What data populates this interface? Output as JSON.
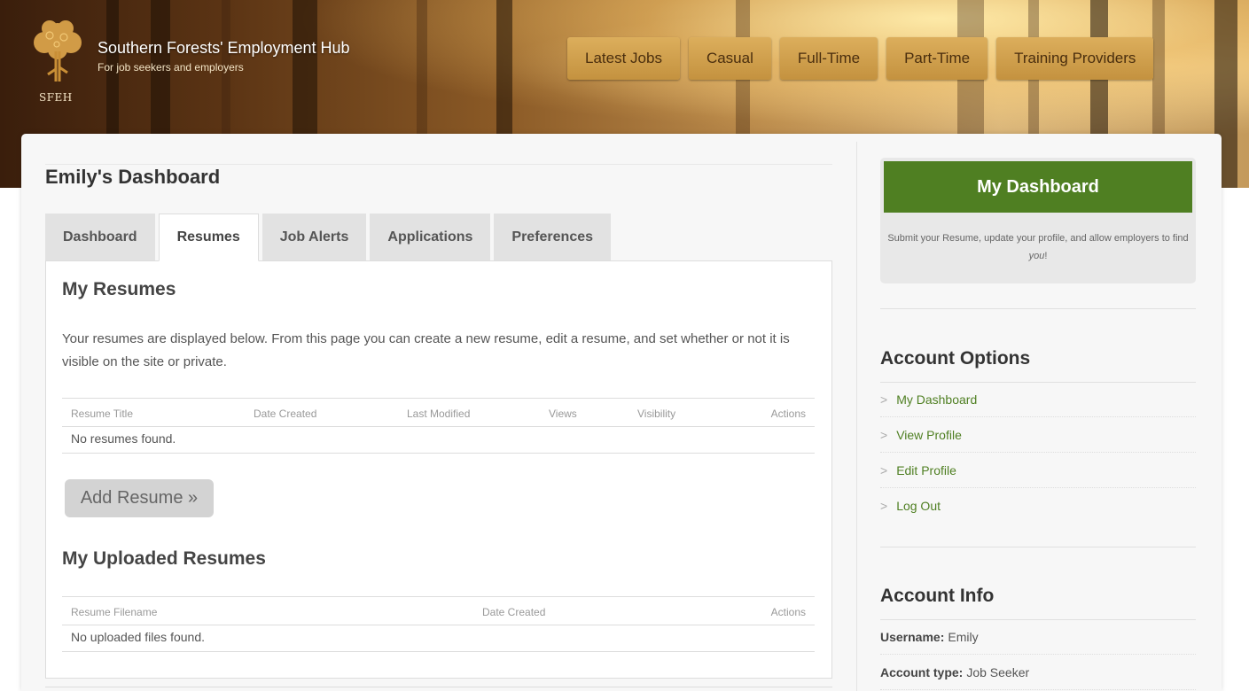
{
  "header": {
    "site_title": "Southern Forests' Employment Hub",
    "site_subtitle": "For job seekers and employers",
    "logo_tag": "SFEH",
    "nav": [
      "Latest Jobs",
      "Casual",
      "Full-Time",
      "Part-Time",
      "Training Providers"
    ]
  },
  "main": {
    "dashboard_title": "Emily's Dashboard",
    "tabs": [
      "Dashboard",
      "Resumes",
      "Job Alerts",
      "Applications",
      "Preferences"
    ],
    "active_tab": "Resumes",
    "my_resumes_heading": "My Resumes",
    "intro_text": "Your resumes are displayed below. From this page you can create a new resume, edit a resume, and set whether or not it is visible on the site or private.",
    "resumes_table": {
      "columns": [
        "Resume Title",
        "Date Created",
        "Last Modified",
        "Views",
        "Visibility",
        "Actions"
      ],
      "empty_text": "No resumes found."
    },
    "add_resume_label": "Add Resume »",
    "uploaded_heading": "My Uploaded Resumes",
    "uploaded_table": {
      "columns": [
        "Resume Filename",
        "Date Created",
        "Actions"
      ],
      "empty_text": "No uploaded files found."
    }
  },
  "sidebar": {
    "dashboard_button": "My Dashboard",
    "dashboard_text_prefix": "Submit your Resume, update your profile, and allow employers to find ",
    "dashboard_text_em": "you",
    "dashboard_text_suffix": "!",
    "account_options_heading": "Account Options",
    "account_options": [
      "My Dashboard",
      "View Profile",
      "Edit Profile",
      "Log Out"
    ],
    "account_info_heading": "Account Info",
    "username_label": "Username:",
    "username_value": "Emily",
    "account_type_label": "Account type:",
    "account_type_value": "Job Seeker"
  },
  "colors": {
    "accent_green": "#4f7f22",
    "nav_gold": "#d3a24f"
  }
}
